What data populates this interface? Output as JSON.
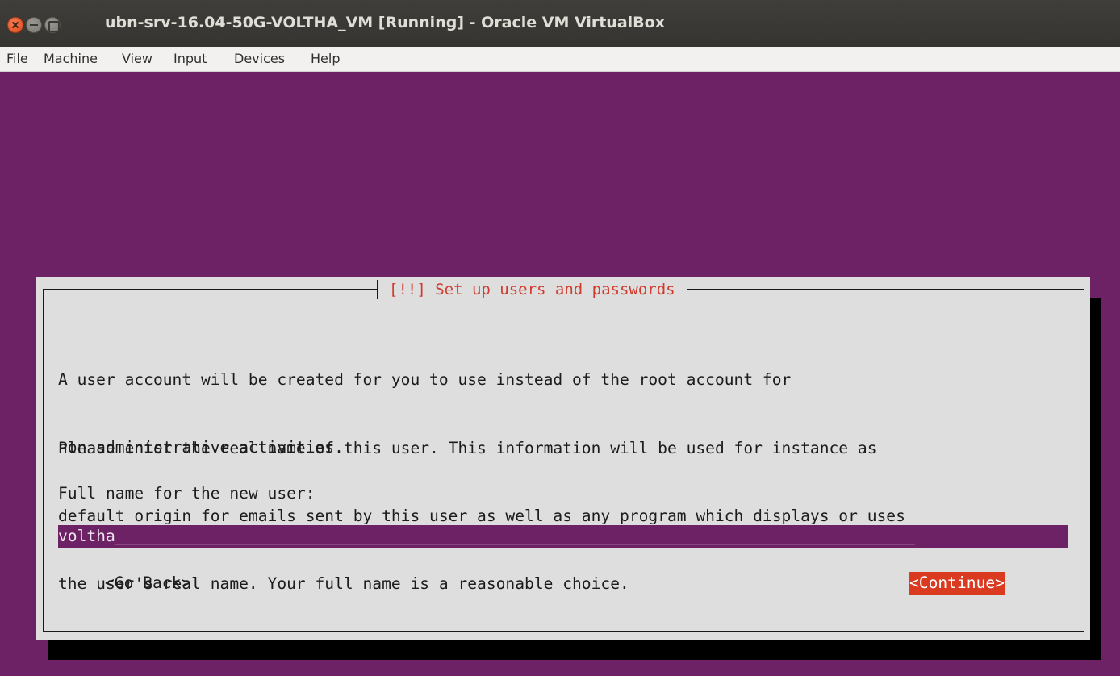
{
  "window": {
    "title": "ubn-srv-16.04-50G-VOLTHA_VM [Running] - Oracle VM VirtualBox"
  },
  "menubar": {
    "items": [
      "File",
      "Machine",
      "View",
      "Input",
      "Devices",
      "Help"
    ]
  },
  "dialog": {
    "title": "[!!] Set up users and passwords",
    "paragraph1": [
      "A user account will be created for you to use instead of the root account for",
      "non-administrative activities."
    ],
    "paragraph2": [
      "Please enter the real name of this user. This information will be used for instance as",
      "default origin for emails sent by this user as well as any program which displays or uses",
      "the user's real name. Your full name is a reasonable choice."
    ],
    "prompt": "Full name for the new user:",
    "input_value": "voltha",
    "input_fill": "____________________________________________________________________________________",
    "back_button": "<Go Back>",
    "continue_button": "<Continue>"
  },
  "colors": {
    "background": "#6d2266",
    "dialog": "#dedede",
    "accent": "#d93a20",
    "title": "#cf3b2c"
  }
}
